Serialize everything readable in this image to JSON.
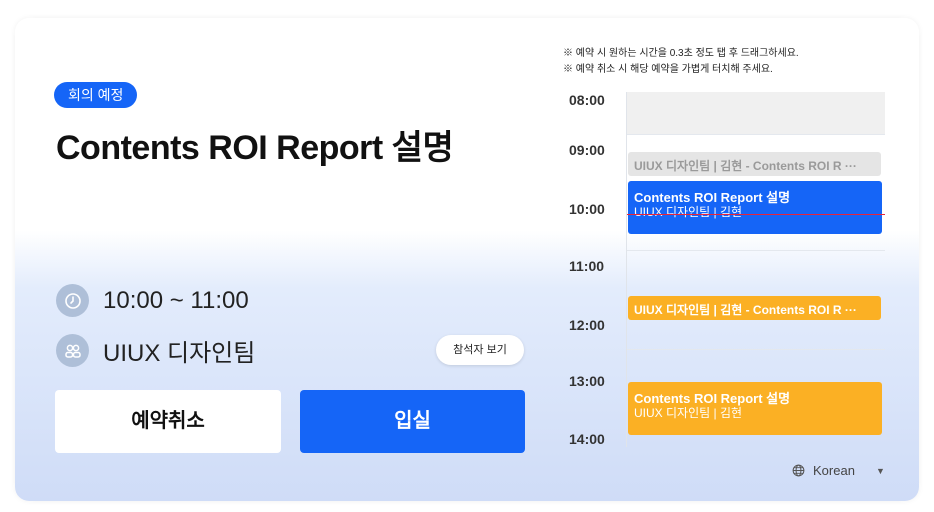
{
  "badge": "회의 예정",
  "title": "Contents ROI Report 설명",
  "time": "10:00 ~ 11:00",
  "room": "UIUX 디자인팀",
  "attendees_button": "참석자 보기",
  "cancel_button": "예약취소",
  "enter_button": "입실",
  "notices": [
    "※ 예약 시 원하는 시간을 0.3초 정도 탭 후 드래그하세요.",
    "※ 예약 취소 시 해당 예약을 가볍게 터치해 주세요."
  ],
  "hours": [
    "08:00",
    "09:00",
    "10:00",
    "11:00",
    "12:00",
    "13:00",
    "14:00"
  ],
  "events": [
    {
      "line1": "UIUX 디자인팀 | 김현 -  Contents ROI R ···",
      "color": "#e5e5e5",
      "text_color": "#9a9a9a"
    },
    {
      "line1": "Contents ROI Report 설명",
      "line2": "UIUX 디자인팀 | 김현",
      "color": "#1565f7"
    },
    {
      "line1": "UIUX 디자인팀 | 김현 -  Contents ROI R ···",
      "color": "#fbb024"
    },
    {
      "line1": "Contents ROI Report 설명",
      "line2": "UIUX 디자인팀 | 김현",
      "color": "#fbb024"
    }
  ],
  "language": "Korean",
  "icons": [
    "clock-icon",
    "people-icon",
    "globe-icon",
    "caret-down-icon"
  ]
}
